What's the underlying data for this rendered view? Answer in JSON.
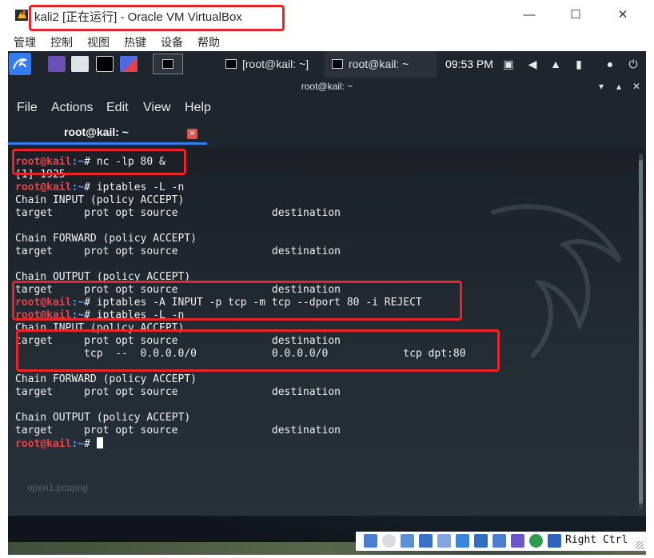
{
  "window": {
    "title": "kali2 [正在运行] - Oracle VM VirtualBox",
    "minimize": "—",
    "maximize": "☐",
    "close": "✕"
  },
  "vbox_menu": [
    "管理",
    "控制",
    "视图",
    "热键",
    "设备",
    "帮助"
  ],
  "panel": {
    "tasks": [
      {
        "label": "[root@kail: ~]"
      },
      {
        "label": "root@kail: ~"
      }
    ],
    "clock": "09:53 PM"
  },
  "terminal": {
    "title": "root@kail: ~",
    "menu": [
      "File",
      "Actions",
      "Edit",
      "View",
      "Help"
    ],
    "tab_label": "root@kail: ~",
    "tab_close": "✕",
    "prompt_user": "root@kail",
    "prompt_path": ":~",
    "prompt_suffix": "# ",
    "lines": [
      {
        "type": "cmd",
        "text": "nc -lp 80 &"
      },
      {
        "type": "out",
        "text": "[1] 1925"
      },
      {
        "type": "cmd",
        "text": "iptables -L -n"
      },
      {
        "type": "out",
        "text": "Chain INPUT (policy ACCEPT)"
      },
      {
        "type": "out",
        "text": "target     prot opt source               destination"
      },
      {
        "type": "out",
        "text": ""
      },
      {
        "type": "out",
        "text": "Chain FORWARD (policy ACCEPT)"
      },
      {
        "type": "out",
        "text": "target     prot opt source               destination"
      },
      {
        "type": "out",
        "text": ""
      },
      {
        "type": "out",
        "text": "Chain OUTPUT (policy ACCEPT)"
      },
      {
        "type": "out",
        "text": "target     prot opt source               destination"
      },
      {
        "type": "cmd",
        "text": "iptables -A INPUT -p tcp -m tcp --dport 80 -i REJECT"
      },
      {
        "type": "cmd",
        "text": "iptables -L -n"
      },
      {
        "type": "out",
        "text": "Chain INPUT (policy ACCEPT)"
      },
      {
        "type": "out",
        "text": "target     prot opt source               destination"
      },
      {
        "type": "out",
        "text": "           tcp  --  0.0.0.0/0            0.0.0.0/0            tcp dpt:80"
      },
      {
        "type": "out",
        "text": ""
      },
      {
        "type": "out",
        "text": "Chain FORWARD (policy ACCEPT)"
      },
      {
        "type": "out",
        "text": "target     prot opt source               destination"
      },
      {
        "type": "out",
        "text": ""
      },
      {
        "type": "out",
        "text": "Chain OUTPUT (policy ACCEPT)"
      },
      {
        "type": "out",
        "text": "target     prot opt source               destination"
      },
      {
        "type": "prompt",
        "text": ""
      }
    ]
  },
  "desktop": {
    "file_label": "open1.pcapng"
  },
  "statusbar": {
    "host_key": "Right Ctrl"
  },
  "colors": {
    "annotation": "#e8242b",
    "prompt_user": "#e8424b",
    "prompt_path": "#5c9cf5",
    "tab_underline": "#367bf0",
    "terminal_bg": "#1f252c"
  }
}
